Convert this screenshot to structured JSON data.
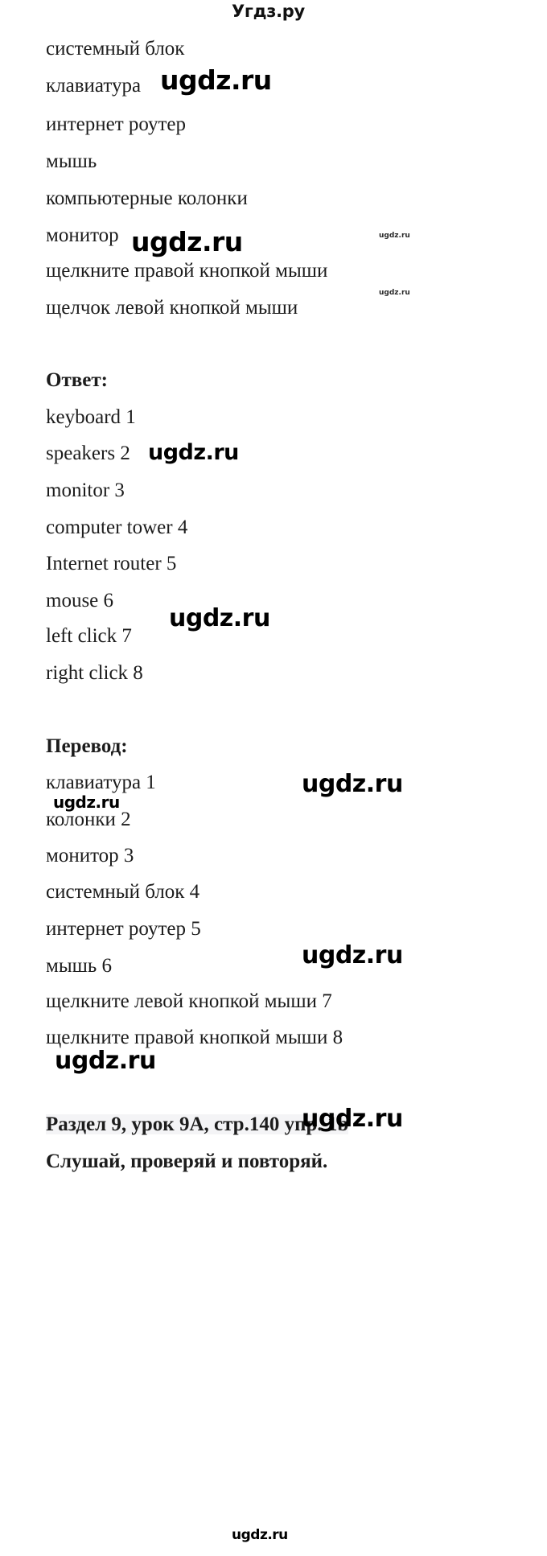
{
  "header": {
    "logo": "Угдз.ру"
  },
  "task_words": {
    "items": [
      "системный блок",
      "клавиатура",
      "интернет роутер",
      "мышь",
      "компьютерные колонки",
      "монитор",
      "щелкните правой кнопкой мыши",
      "щелчок левой кнопкой мыши"
    ]
  },
  "answer_section": {
    "heading": "Ответ:",
    "items": [
      "keyboard 1",
      "speakers 2",
      "monitor 3",
      "computer tower 4",
      "Internet router 5",
      "mouse 6",
      "left click 7",
      "right click 8"
    ]
  },
  "translation_section": {
    "heading": "Перевод:",
    "items": [
      "клавиатура 1",
      "колонки 2",
      "монитор 3",
      "системный блок 4",
      "интернет роутер 5",
      "мышь 6",
      "щелкните левой кнопкой мыши 7",
      "щелкните правой кнопкой мыши 8"
    ]
  },
  "next_task": {
    "reference": "Раздел 9, урок 9А, стр.140 упр. 1b",
    "instruction": "Слушай, проверяй и повторяй."
  },
  "watermarks": {
    "text": "ugdz.ru",
    "items": [
      "ugdz.ru",
      "ugdz.ru",
      "ugdz.ru",
      "ugdz.ru",
      "ugdz.ru",
      "ugdz.ru",
      "ugdz.ru",
      "ugdz.ru",
      "ugdz.ru",
      "ugdz.ru",
      "ugdz.ru",
      "ugdz.ru",
      "ugdz.ru"
    ]
  },
  "colors": {
    "page_background": "#ffffff",
    "text": "#1c1c1c",
    "highlight": "#f4f4f6"
  }
}
